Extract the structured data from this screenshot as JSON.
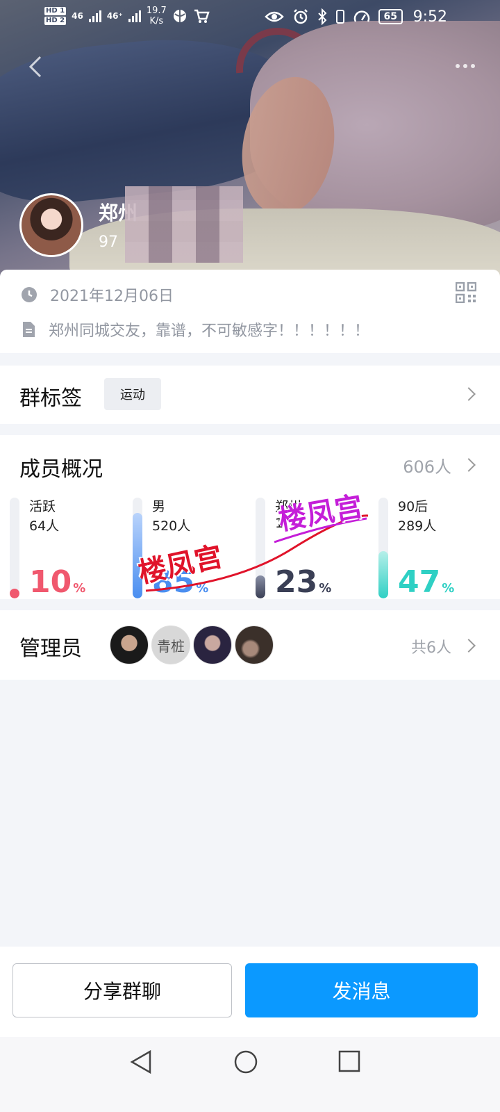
{
  "status_bar": {
    "hd1": "HD 1",
    "hd2": "HD 2",
    "net1": "46",
    "net2": "46⁺",
    "speed_value": "19.7",
    "speed_unit": "K/s",
    "battery": "65",
    "time": "9:52"
  },
  "header": {
    "group_name": "郑州",
    "group_id": "97"
  },
  "info": {
    "date": "2021年12月06日",
    "description": "郑州同城交友，靠谱，不可敏感字！！！！！！"
  },
  "tags": {
    "title": "群标签",
    "items": [
      "运动"
    ]
  },
  "members": {
    "title": "成员概况",
    "total": "606人",
    "stats": [
      {
        "label": "活跃",
        "count": "64人",
        "percent": 10,
        "color": "#f0586e"
      },
      {
        "label": "男",
        "count": "520人",
        "percent": 85,
        "color": "#4a8ef0"
      },
      {
        "label": "郑州",
        "count": "1",
        "percent": 23,
        "color": "#3a3f55"
      },
      {
        "label": "90后",
        "count": "289人",
        "percent": 47,
        "color": "#2fd0c4"
      }
    ],
    "percent_sign": "%"
  },
  "admins": {
    "title": "管理员",
    "count": "共6人",
    "avatars": [
      "admin-avatar-1",
      "admin-avatar-2",
      "admin-avatar-3",
      "admin-avatar-4"
    ],
    "avatar2_text": "青桩"
  },
  "watermark": {
    "text": "楼凤宫",
    "colors": [
      "#e0132a",
      "#c41ed8"
    ]
  },
  "actions": {
    "share": "分享群聊",
    "send": "发消息"
  },
  "colors": {
    "primary": "#0b99ff",
    "muted": "#9297a1"
  }
}
